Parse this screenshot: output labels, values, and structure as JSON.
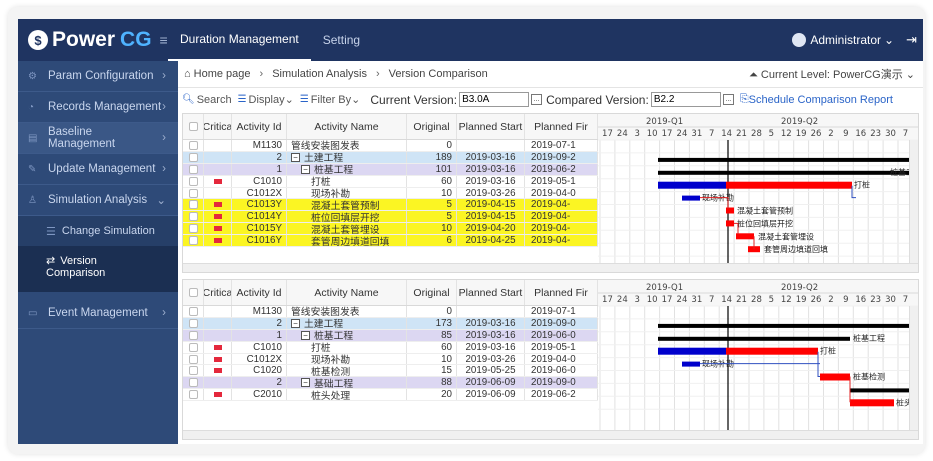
{
  "app": {
    "logo_text": "Power",
    "logo_cg": "CG",
    "logo_mark": "$",
    "menu_icon": "hamburger-icon"
  },
  "topnav": {
    "tabs": [
      {
        "label": "Duration Management",
        "active": true
      },
      {
        "label": "Setting",
        "active": false
      }
    ],
    "user": "Administrator",
    "user_caret": "⌄",
    "logout_icon": "logout-icon"
  },
  "sidebar": {
    "items": [
      {
        "label": "Param Configuration",
        "icon": "gear-icon"
      },
      {
        "label": "Records Management",
        "icon": "records-icon"
      },
      {
        "label": "Baseline Management",
        "icon": "baseline-icon"
      },
      {
        "label": "Update Management",
        "icon": "edit-icon"
      },
      {
        "label": "Simulation Analysis",
        "icon": "user-icon"
      },
      {
        "label": "Event Management",
        "icon": "event-icon"
      }
    ],
    "sub_change": "Change Simulation",
    "sub_version_1": "Version",
    "sub_version_2": "Comparison"
  },
  "breadcrumb": {
    "home": "Home page",
    "level2": "Simulation Analysis",
    "level3": "Version Comparison",
    "current_level": "Current Level:  PowerCG演示"
  },
  "toolbar": {
    "search": "Search",
    "display": "Display",
    "filter_by": "Filter By",
    "current_version_label": "Current Version:",
    "current_version_value": "B3.0A",
    "compared_version_label": "Compared Version:",
    "compared_version_value": "B2.2",
    "report": "Schedule Comparison Report",
    "dots": "..."
  },
  "grid_headers": {
    "critical": "Critica",
    "activity_id": "Activity Id",
    "activity_name": "Activity Name",
    "original": "Original",
    "planned_start": "Planned Start",
    "planned_finish": "Planned Fir"
  },
  "top_rows": [
    {
      "id": "M1130",
      "name": "管线安装图发表",
      "orig": "0",
      "ps": "",
      "pf": "2019-07-1",
      "style": "",
      "flag": false,
      "expander": "",
      "indent": 0
    },
    {
      "id": "2",
      "name": "土建工程",
      "orig": "189",
      "ps": "2019-03-16",
      "pf": "2019-09-2",
      "style": "blue",
      "flag": false,
      "expander": "⊟",
      "indent": 0
    },
    {
      "id": "1",
      "name": "桩基工程",
      "orig": "101",
      "ps": "2019-03-16",
      "pf": "2019-06-2",
      "style": "purple",
      "flag": false,
      "expander": "⊟",
      "indent": 1
    },
    {
      "id": "C1010",
      "name": "打桩",
      "orig": "60",
      "ps": "2019-03-16",
      "pf": "2019-05-1",
      "style": "",
      "flag": true,
      "expander": "",
      "indent": 2
    },
    {
      "id": "C1012X",
      "name": "现场补勘",
      "orig": "10",
      "ps": "2019-03-26",
      "pf": "2019-04-0",
      "style": "",
      "flag": false,
      "expander": "",
      "indent": 2
    },
    {
      "id": "C1013Y",
      "name": "混凝土套管预制",
      "orig": "5",
      "ps": "2019-04-15",
      "pf": "2019-04-",
      "style": "yellow",
      "flag": true,
      "expander": "",
      "indent": 2
    },
    {
      "id": "C1014Y",
      "name": "桩位回填层开挖",
      "orig": "5",
      "ps": "2019-04-15",
      "pf": "2019-04-",
      "style": "yellow",
      "flag": true,
      "expander": "",
      "indent": 2
    },
    {
      "id": "C1015Y",
      "name": "混凝土套管埋设",
      "orig": "10",
      "ps": "2019-04-20",
      "pf": "2019-04-",
      "style": "yellow",
      "flag": true,
      "expander": "",
      "indent": 2
    },
    {
      "id": "C1016Y",
      "name": "套管周边填道回填",
      "orig": "6",
      "ps": "2019-04-25",
      "pf": "2019-04-",
      "style": "yellow",
      "flag": true,
      "expander": "",
      "indent": 2
    }
  ],
  "bottom_rows": [
    {
      "id": "M1130",
      "name": "管线安装图发表",
      "orig": "0",
      "ps": "",
      "pf": "2019-07-1",
      "style": "",
      "flag": false,
      "expander": "",
      "indent": 0
    },
    {
      "id": "2",
      "name": "土建工程",
      "orig": "173",
      "ps": "2019-03-16",
      "pf": "2019-09-0",
      "style": "blue",
      "flag": false,
      "expander": "⊟",
      "indent": 0
    },
    {
      "id": "1",
      "name": "桩基工程",
      "orig": "85",
      "ps": "2019-03-16",
      "pf": "2019-06-0",
      "style": "purple",
      "flag": false,
      "expander": "⊟",
      "indent": 1
    },
    {
      "id": "C1010",
      "name": "打桩",
      "orig": "60",
      "ps": "2019-03-16",
      "pf": "2019-05-1",
      "style": "",
      "flag": true,
      "expander": "",
      "indent": 2
    },
    {
      "id": "C1012X",
      "name": "现场补勘",
      "orig": "10",
      "ps": "2019-03-26",
      "pf": "2019-04-0",
      "style": "",
      "flag": true,
      "expander": "",
      "indent": 2
    },
    {
      "id": "C1020",
      "name": "桩基检测",
      "orig": "15",
      "ps": "2019-05-25",
      "pf": "2019-06-0",
      "style": "",
      "flag": true,
      "expander": "",
      "indent": 2
    },
    {
      "id": "2",
      "name": "基础工程",
      "orig": "88",
      "ps": "2019-06-09",
      "pf": "2019-09-0",
      "style": "purple",
      "flag": false,
      "expander": "⊟",
      "indent": 1
    },
    {
      "id": "C2010",
      "name": "桩头处理",
      "orig": "20",
      "ps": "2019-06-09",
      "pf": "2019-06-2",
      "style": "",
      "flag": true,
      "expander": "",
      "indent": 2
    }
  ],
  "gantt": {
    "quarters": [
      "2019-Q1",
      "2019-Q2"
    ],
    "days": [
      "17",
      "24",
      "3",
      "10",
      "17",
      "24",
      "31",
      "7",
      "14",
      "21",
      "28",
      "5",
      "12",
      "19",
      "26",
      "2",
      "9",
      "16",
      "23",
      "30",
      "7"
    ],
    "top_labels": [
      "桩基工程",
      "打桩",
      "现场补勘",
      "混凝土套管预制",
      "桩位回填层开挖",
      "混凝土套管埋设",
      "套管周边填道回填"
    ],
    "bottom_labels": [
      "桩基工程",
      "打桩",
      "现场补勘",
      "桩基检测",
      "桩头处"
    ],
    "colors": {
      "summary": "#000000",
      "current": "#ff0000",
      "baseline": "#0000cc",
      "grid": "#e1e1e1"
    }
  }
}
